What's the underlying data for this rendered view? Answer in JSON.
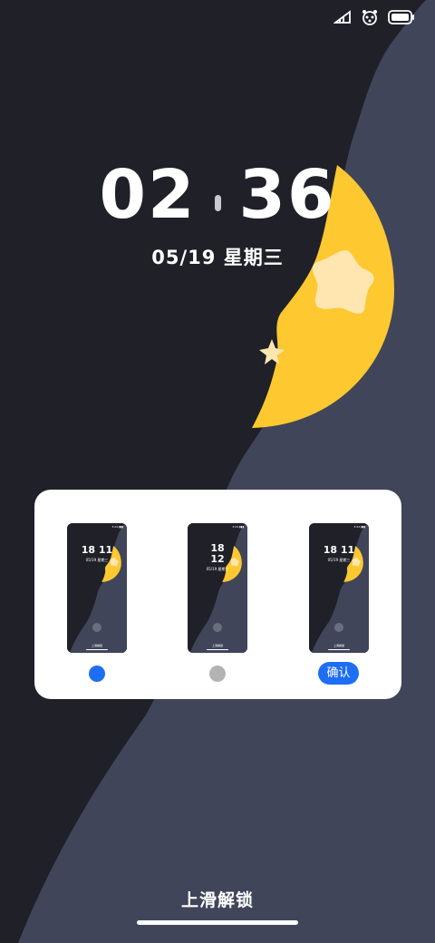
{
  "lockscreen": {
    "time_hour": "02",
    "time_minute": "36",
    "date": "05/19 星期三",
    "unlock_hint": "上滑解锁"
  },
  "status_bar": {
    "icons": [
      "signal-icon",
      "paw-icon",
      "battery-icon"
    ]
  },
  "wallpaper_picker": {
    "options": [
      {
        "time": "18 11",
        "date": "05/19 星期三",
        "unlock": "上滑解锁",
        "status": "3:24 ▮▮▮",
        "selected": true
      },
      {
        "time_line1": "18",
        "time_line2": "12",
        "date": "05/19 星期三",
        "unlock": "上滑解锁",
        "status": "3:24 ▮▮▮",
        "selected": false
      },
      {
        "time": "18 11",
        "date": "05/19 星期三",
        "unlock": "上滑解锁",
        "status": "3:24 ▮▮▮",
        "selected": false
      }
    ],
    "confirm_label": "确认"
  },
  "colors": {
    "background_dark": "#1f2028",
    "slate": "#40455a",
    "moon_yellow": "#fdc830",
    "star_cream": "#ffe6b0",
    "accent_blue": "#1e6ef4",
    "unselected_gray": "#b3b3b3"
  }
}
